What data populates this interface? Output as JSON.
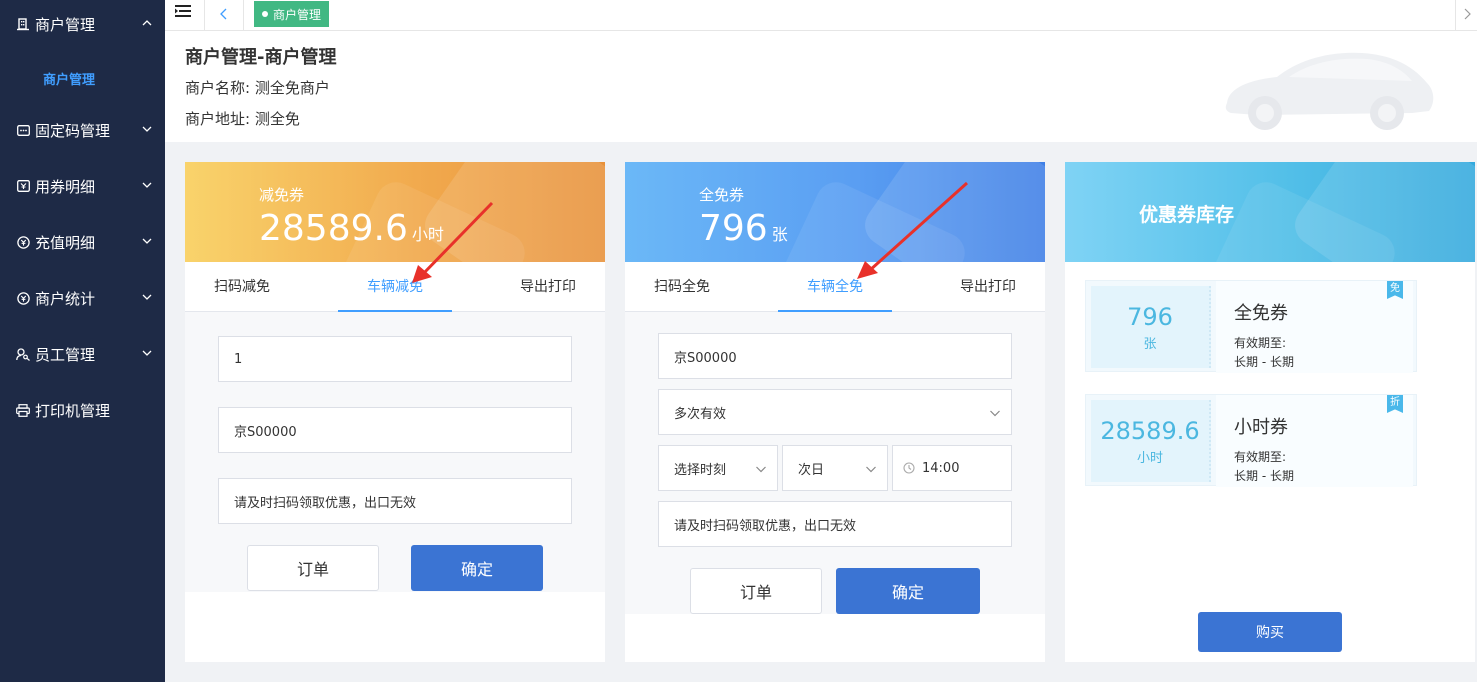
{
  "sidebar": {
    "items": [
      {
        "label": "商户管理",
        "icon": "building-icon",
        "expanded": true
      },
      {
        "label": "固定码管理",
        "icon": "keypad-icon",
        "expanded": false
      },
      {
        "label": "用券明细",
        "icon": "ticket-icon",
        "expanded": false
      },
      {
        "label": "充值明细",
        "icon": "coin-icon",
        "expanded": false
      },
      {
        "label": "商户统计",
        "icon": "coin-icon",
        "expanded": false
      },
      {
        "label": "员工管理",
        "icon": "user-key-icon",
        "expanded": false
      },
      {
        "label": "打印机管理",
        "icon": "printer-icon"
      }
    ],
    "submenu": {
      "label": "商户管理"
    }
  },
  "topbar": {
    "active_tag": "商户管理"
  },
  "header": {
    "title": "商户管理-商户管理",
    "name_label": "商户名称:",
    "name_value": "测全免商户",
    "addr_label": "商户地址:",
    "addr_value": "测全免"
  },
  "card_reduce": {
    "label": "减免券",
    "value": "28589.6",
    "unit": "小时",
    "tabs": [
      "扫码减免",
      "车辆减免",
      "导出打印"
    ],
    "active_tab": 1,
    "fields": {
      "amount": "1",
      "plate": "京S00000",
      "note": "请及时扫码领取优惠，出口无效"
    },
    "btn_order": "订单",
    "btn_confirm": "确定"
  },
  "card_free": {
    "label": "全免券",
    "value": "796",
    "unit": "张",
    "tabs": [
      "扫码全免",
      "车辆全免",
      "导出打印"
    ],
    "active_tab": 1,
    "fields": {
      "plate": "京S00000",
      "validity": "多次有效",
      "time_select": "选择时刻",
      "day_select": "次日",
      "time_value": "14:00",
      "note": "请及时扫码领取优惠，出口无效"
    },
    "btn_order": "订单",
    "btn_confirm": "确定"
  },
  "inventory": {
    "title": "优惠券库存",
    "items": [
      {
        "count": "796",
        "unit": "张",
        "title": "全免券",
        "valid_label": "有效期至:",
        "range": "长期 - 长期",
        "badge": "免"
      },
      {
        "count": "28589.6",
        "unit": "小时",
        "title": "小时券",
        "valid_label": "有效期至:",
        "range": "长期 - 长期",
        "badge": "折"
      }
    ],
    "buy_label": "购买"
  },
  "colors": {
    "sidebar_bg": "#1e2a46",
    "accent": "#409eff",
    "primary_button": "#3b74d3",
    "tag_green": "#41b883",
    "annotation_arrow": "#e8312a"
  }
}
